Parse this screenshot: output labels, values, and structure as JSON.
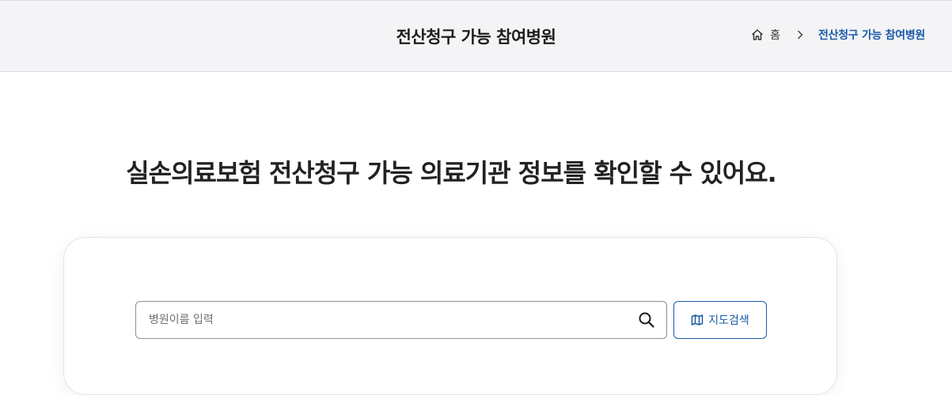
{
  "header": {
    "title": "전산청구 가능 참여병원",
    "breadcrumb": {
      "home_icon": "home-icon",
      "home_label": "홈",
      "separator_icon": "chevron-right-icon",
      "current_label": "전산청구 가능 참여병원"
    }
  },
  "main": {
    "headline": "실손의료보험 전산청구 가능 의료기관 정보를 확인할 수 있어요.",
    "search": {
      "placeholder": "병원이름 입력",
      "value": "",
      "search_icon": "search-icon"
    },
    "map_button": {
      "icon": "map-icon",
      "label": "지도검색"
    }
  },
  "colors": {
    "accent": "#1a5aa8",
    "header_bg": "#f4f4f6"
  }
}
